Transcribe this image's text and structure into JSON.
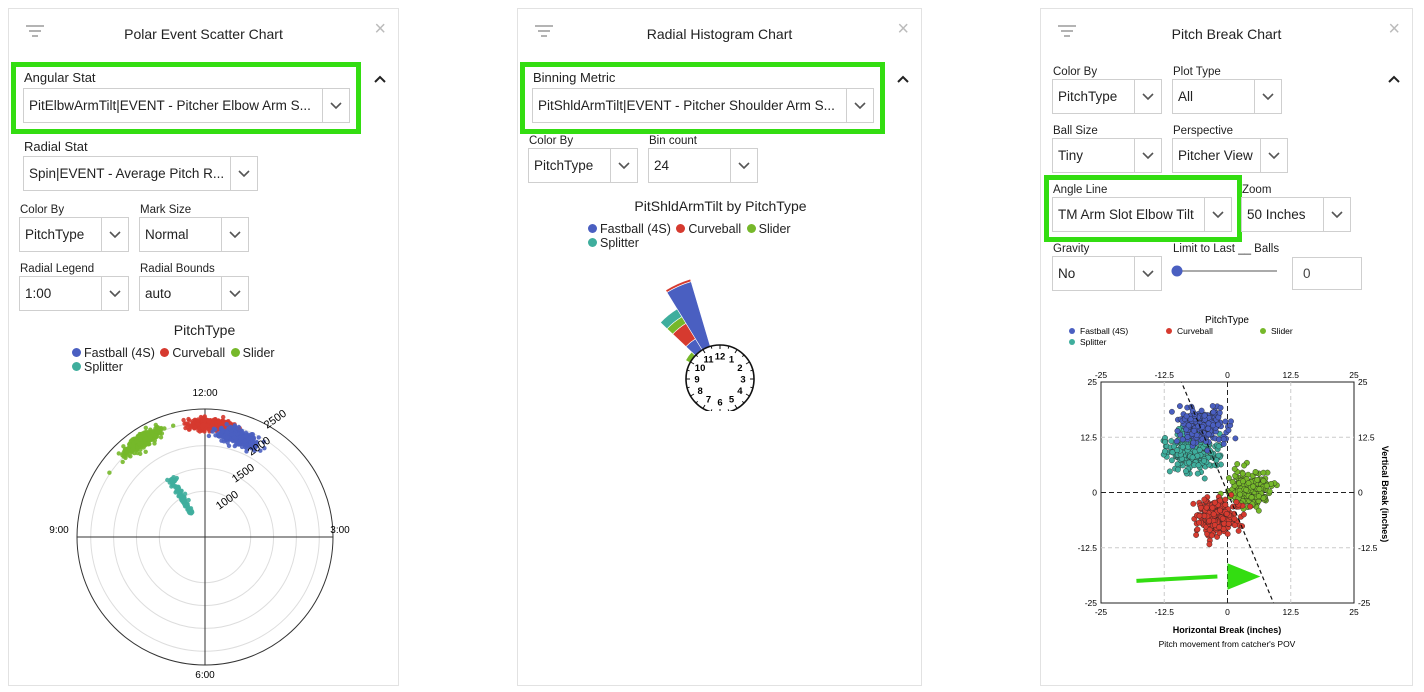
{
  "colors": {
    "fastball": "#4a5fc1",
    "curveball": "#d63a2f",
    "slider": "#76b82a",
    "splitter": "#3fae9d",
    "highlight": "#33dd11"
  },
  "icons": {
    "filter": "filter-icon",
    "close": "close-icon",
    "collapse": "chevron-up-icon",
    "dropdown": "chevron-down-icon"
  },
  "panel1": {
    "title": "Polar Event Scatter Chart",
    "angular_stat_label": "Angular Stat",
    "angular_stat_value": "PitElbwArmTilt|EVENT - Pitcher Elbow Arm S...",
    "radial_stat_label": "Radial Stat",
    "radial_stat_value": "Spin|EVENT - Average Pitch R...",
    "color_by_label": "Color By",
    "color_by_value": "PitchType",
    "mark_size_label": "Mark Size",
    "mark_size_value": "Normal",
    "radial_legend_label": "Radial Legend",
    "radial_legend_value": "1:00",
    "radial_bounds_label": "Radial Bounds",
    "radial_bounds_value": "auto",
    "chart_title": "PitchType",
    "legend": [
      "Fastball (4S)",
      "Curveball",
      "Slider",
      "Splitter"
    ]
  },
  "panel2": {
    "title": "Radial Histogram Chart",
    "binning_metric_label": "Binning Metric",
    "binning_metric_value": "PitShldArmTilt|EVENT - Pitcher Shoulder Arm S...",
    "color_by_label": "Color By",
    "color_by_value": "PitchType",
    "bin_count_label": "Bin count",
    "bin_count_value": "24",
    "chart_title": "PitShldArmTilt by PitchType",
    "legend": [
      "Fastball (4S)",
      "Curveball",
      "Slider",
      "Splitter"
    ]
  },
  "panel3": {
    "title": "Pitch Break Chart",
    "color_by_label": "Color By",
    "color_by_value": "PitchType",
    "plot_type_label": "Plot Type",
    "plot_type_value": "All",
    "ball_size_label": "Ball Size",
    "ball_size_value": "Tiny",
    "perspective_label": "Perspective",
    "perspective_value": "Pitcher View",
    "angle_line_label": "Angle Line",
    "angle_line_value": "TM Arm Slot Elbow Tilt",
    "zoom_label": "Zoom",
    "zoom_value": "50 Inches",
    "gravity_label": "Gravity",
    "gravity_value": "No",
    "limit_label": "Limit to Last __ Balls",
    "limit_slider_value": 0,
    "limit_input_value": "0",
    "legend_title": "PitchType",
    "legend": [
      "Fastball (4S)",
      "Curveball",
      "Slider",
      "Splitter"
    ]
  },
  "chart_data": [
    {
      "type": "scatter",
      "title": "PitchType",
      "polar": true,
      "angular_ticks": [
        "12:00",
        "3:00",
        "6:00",
        "9:00"
      ],
      "radial_ticks": [
        "1000",
        "1500",
        "2000",
        "2500"
      ],
      "series": [
        {
          "name": "Fastball (4S)",
          "angle_clock": 12.6,
          "radius_range": [
            2150,
            2450
          ]
        },
        {
          "name": "Curveball",
          "angle_clock": 12.1,
          "radius_range": [
            2350,
            2600
          ]
        },
        {
          "name": "Slider",
          "angle_clock": 10.9,
          "radius_range": [
            2400,
            2650
          ]
        },
        {
          "name": "Splitter",
          "angle_clock": 11.0,
          "radius_range": [
            600,
            1500
          ]
        }
      ]
    },
    {
      "type": "bar",
      "title": "PitShldArmTilt by PitchType",
      "polar": true,
      "clock_ticks": [
        "12",
        "1",
        "2",
        "3",
        "4",
        "5",
        "6",
        "7",
        "8",
        "9",
        "10",
        "11"
      ],
      "bins": [
        {
          "angle_clock": 11.2,
          "stack": [
            {
              "series": "Fastball (4S)",
              "value": 52
            },
            {
              "series": "Curveball",
              "value": 2
            },
            {
              "series": "Slider",
              "value": 0
            },
            {
              "series": "Splitter",
              "value": 0
            }
          ]
        },
        {
          "angle_clock": 10.7,
          "stack": [
            {
              "series": "Fastball (4S)",
              "value": 10
            },
            {
              "series": "Curveball",
              "value": 14
            },
            {
              "series": "Slider",
              "value": 6
            },
            {
              "series": "Splitter",
              "value": 7
            }
          ]
        },
        {
          "angle_clock": 10.2,
          "stack": [
            {
              "series": "Slider",
              "value": 4
            }
          ]
        }
      ]
    },
    {
      "type": "scatter",
      "title": "Pitch movement from catcher's POV",
      "xlabel": "Horizontal Break (inches)",
      "ylabel": "Vertical Break (inches)",
      "xlim": [
        -25,
        25
      ],
      "ylim": [
        -25,
        25
      ],
      "xticks": [
        -25,
        -12.5,
        0,
        12.5,
        25
      ],
      "yticks": [
        -25,
        -12.5,
        0,
        12.5,
        25
      ],
      "series": [
        {
          "name": "Fastball (4S)",
          "center": [
            -5,
            15
          ],
          "spread": [
            3.5,
            3
          ]
        },
        {
          "name": "Curveball",
          "center": [
            -2,
            -5.5
          ],
          "spread": [
            3,
            3
          ]
        },
        {
          "name": "Slider",
          "center": [
            4.5,
            1
          ],
          "spread": [
            3,
            3
          ]
        },
        {
          "name": "Splitter",
          "center": [
            -7,
            9
          ],
          "spread": [
            4,
            3.5
          ]
        }
      ],
      "angle_line": {
        "angle_deg": 110
      }
    }
  ]
}
